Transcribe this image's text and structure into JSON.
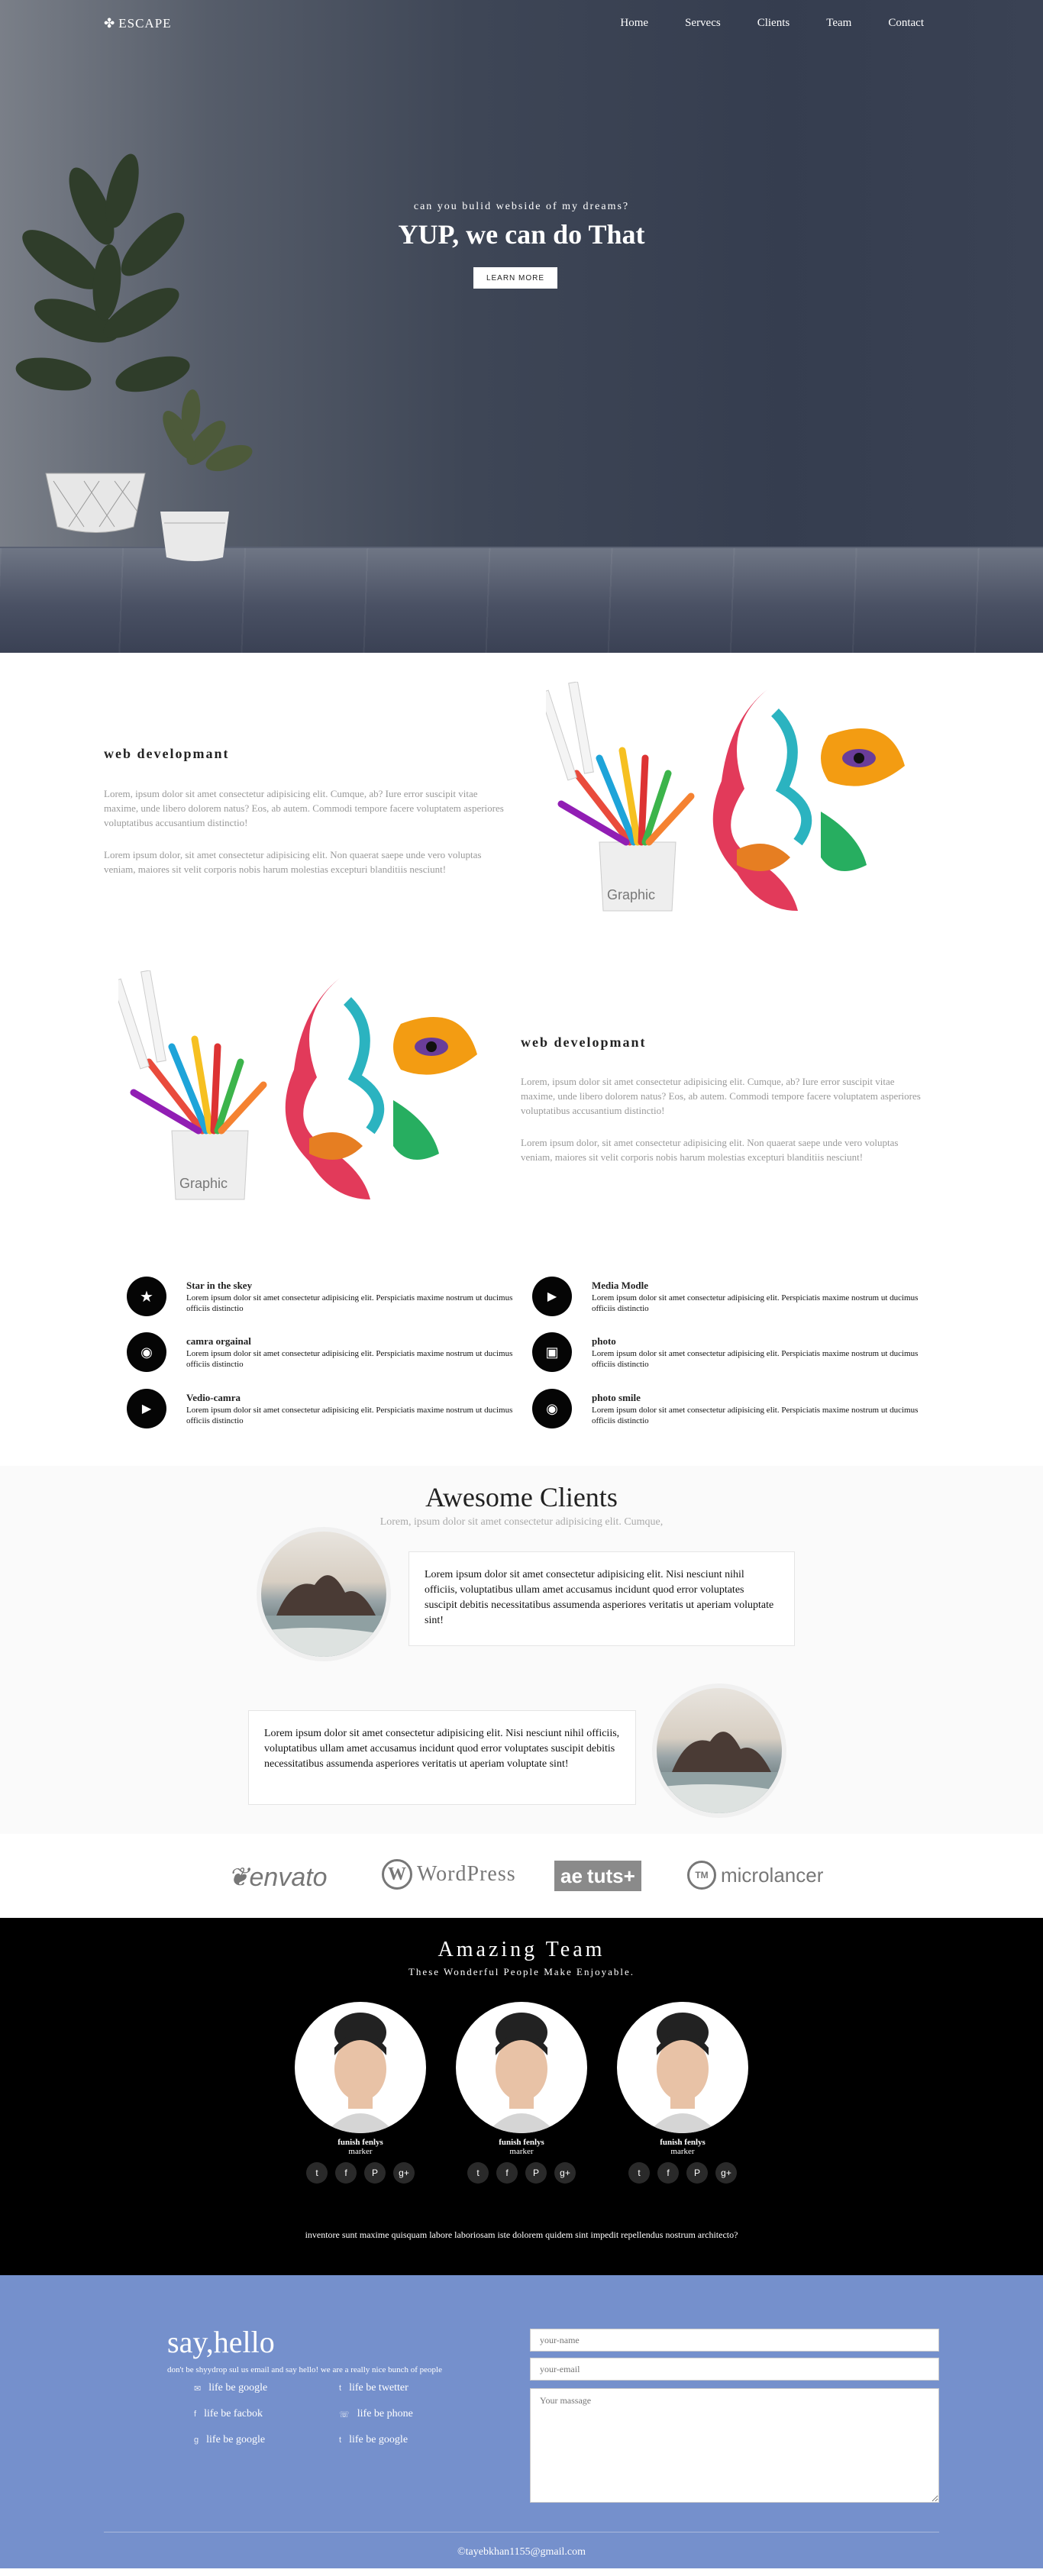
{
  "nav": {
    "logo": "ESCAPE",
    "items": [
      "Home",
      "Servecs",
      "Clients",
      "Team",
      "Contact"
    ]
  },
  "hero": {
    "subtitle": "can you bulid webside of my dreams?",
    "title": "YUP, we can do That",
    "button": "LEARN MORE"
  },
  "feature1": {
    "title": "web developmant",
    "p1": "Lorem, ipsum dolor sit amet consectetur adipisicing elit. Cumque, ab? Iure error suscipit vitae maxime, unde libero dolorem natus? Eos, ab autem. Commodi tempore facere voluptatem asperiores voluptatibus accusantium distinctio!",
    "p2": "Lorem ipsum dolor, sit amet consectetur adipisicing elit. Non quaerat saepe unde vero voluptas veniam, maiores sit velit corporis nobis harum molestias excepturi blanditiis nesciunt!",
    "art_label": "Graphic"
  },
  "feature2": {
    "title": "web developmant",
    "p1": "Lorem, ipsum dolor sit amet consectetur adipisicing elit. Cumque, ab? Iure error suscipit vitae maxime, unde libero dolorem natus? Eos, ab autem. Commodi tempore facere voluptatem asperiores voluptatibus accusantium distinctio!",
    "p2": "Lorem ipsum dolor, sit amet consectetur adipisicing elit. Non quaerat saepe unde vero voluptas veniam, maiores sit velit corporis nobis harum molestias excepturi blanditiis nesciunt!",
    "art_label": "Graphic"
  },
  "services": [
    {
      "title": "Star in the skey",
      "icon": "star-icon",
      "glyph": "★",
      "text": "Lorem ipsum dolor sit amet consectetur adipisicing elit. Perspiciatis maxime nostrum ut ducimus officiis distinctio"
    },
    {
      "title": "Media Modle",
      "icon": "video-icon",
      "glyph": "▶",
      "text": "Lorem ipsum dolor sit amet consectetur adipisicing elit. Perspiciatis maxime nostrum ut ducimus officiis distinctio"
    },
    {
      "title": "camra orgainal",
      "icon": "camera-icon",
      "glyph": "◉",
      "text": "Lorem ipsum dolor sit amet consectetur adipisicing elit. Perspiciatis maxime nostrum ut ducimus officiis distinctio"
    },
    {
      "title": "photo",
      "icon": "image-icon",
      "glyph": "▣",
      "text": "Lorem ipsum dolor sit amet consectetur adipisicing elit. Perspiciatis maxime nostrum ut ducimus officiis distinctio"
    },
    {
      "title": "Vedio-camra",
      "icon": "video-camera-icon",
      "glyph": "▶",
      "text": "Lorem ipsum dolor sit amet consectetur adipisicing elit. Perspiciatis maxime nostrum ut ducimus officiis distinctio"
    },
    {
      "title": "photo smile",
      "icon": "camera-icon",
      "glyph": "◉",
      "text": "Lorem ipsum dolor sit amet consectetur adipisicing elit. Perspiciatis maxime nostrum ut ducimus officiis distinctio"
    }
  ],
  "clients": {
    "title": "Awesome Clients",
    "subtitle": "Lorem, ipsum dolor sit amet consectetur adipisicing elit. Cumque,",
    "t1": "Lorem ipsum dolor sit amet consectetur adipisicing elit. Nisi nesciunt nihil officiis, voluptatibus ullam amet accusamus incidunt quod error voluptates suscipit debitis necessitatibus assumenda asperiores veritatis ut aperiam voluptate sint!",
    "t2": "Lorem ipsum dolor sit amet consectetur adipisicing elit. Nisi nesciunt nihil officiis, voluptatibus ullam amet accusamus incidunt quod error voluptates suscipit debitis necessitatibus assumenda asperiores veritatis ut aperiam voluptate sint!"
  },
  "partners": {
    "envato": "envato",
    "wordpress": "WordPress",
    "tuts_a": "ae",
    "tuts_b": "tuts+",
    "micro_badge": "TM",
    "microlancer": "microlancer"
  },
  "team": {
    "title": "Amazing Team",
    "subtitle": "These Wonderful People Make Enjoyable.",
    "members": [
      {
        "name": "funish fenlys",
        "role": "marker"
      },
      {
        "name": "funish fenlys",
        "role": "marker"
      },
      {
        "name": "funish fenlys",
        "role": "marker"
      }
    ],
    "social": {
      "twitter": "t",
      "facebook": "f",
      "pinterest": "P",
      "google": "g+"
    },
    "footer": "inventore sunt maxime quisquam labore laboriosam iste dolorem quidem sint impedit repellendus nostrum architecto?"
  },
  "contact": {
    "title": "say,hello",
    "intro": "don't be shyydrop sul us email and say hello! we are a really nice bunch of people",
    "links": [
      {
        "label": "life be google",
        "icon": "envelope-icon",
        "glyph": "✉"
      },
      {
        "label": "life be twetter",
        "icon": "twitter-icon",
        "glyph": "t"
      },
      {
        "label": "life be facbok",
        "icon": "facebook-icon",
        "glyph": "f"
      },
      {
        "label": "life be phone",
        "icon": "phone-icon",
        "glyph": "☏"
      },
      {
        "label": "life be google",
        "icon": "google-icon",
        "glyph": "g"
      },
      {
        "label": "life be google",
        "icon": "twitter-icon",
        "glyph": "t"
      }
    ],
    "name_ph": "your-name",
    "email_ph": "your-email",
    "msg_ph": "Your massage",
    "email": "©tayebkhan1155@gmail.com"
  },
  "colors": {
    "contact_bg": "#7590cc",
    "team_bg": "#000000",
    "hero_wall": "#353d4f"
  }
}
